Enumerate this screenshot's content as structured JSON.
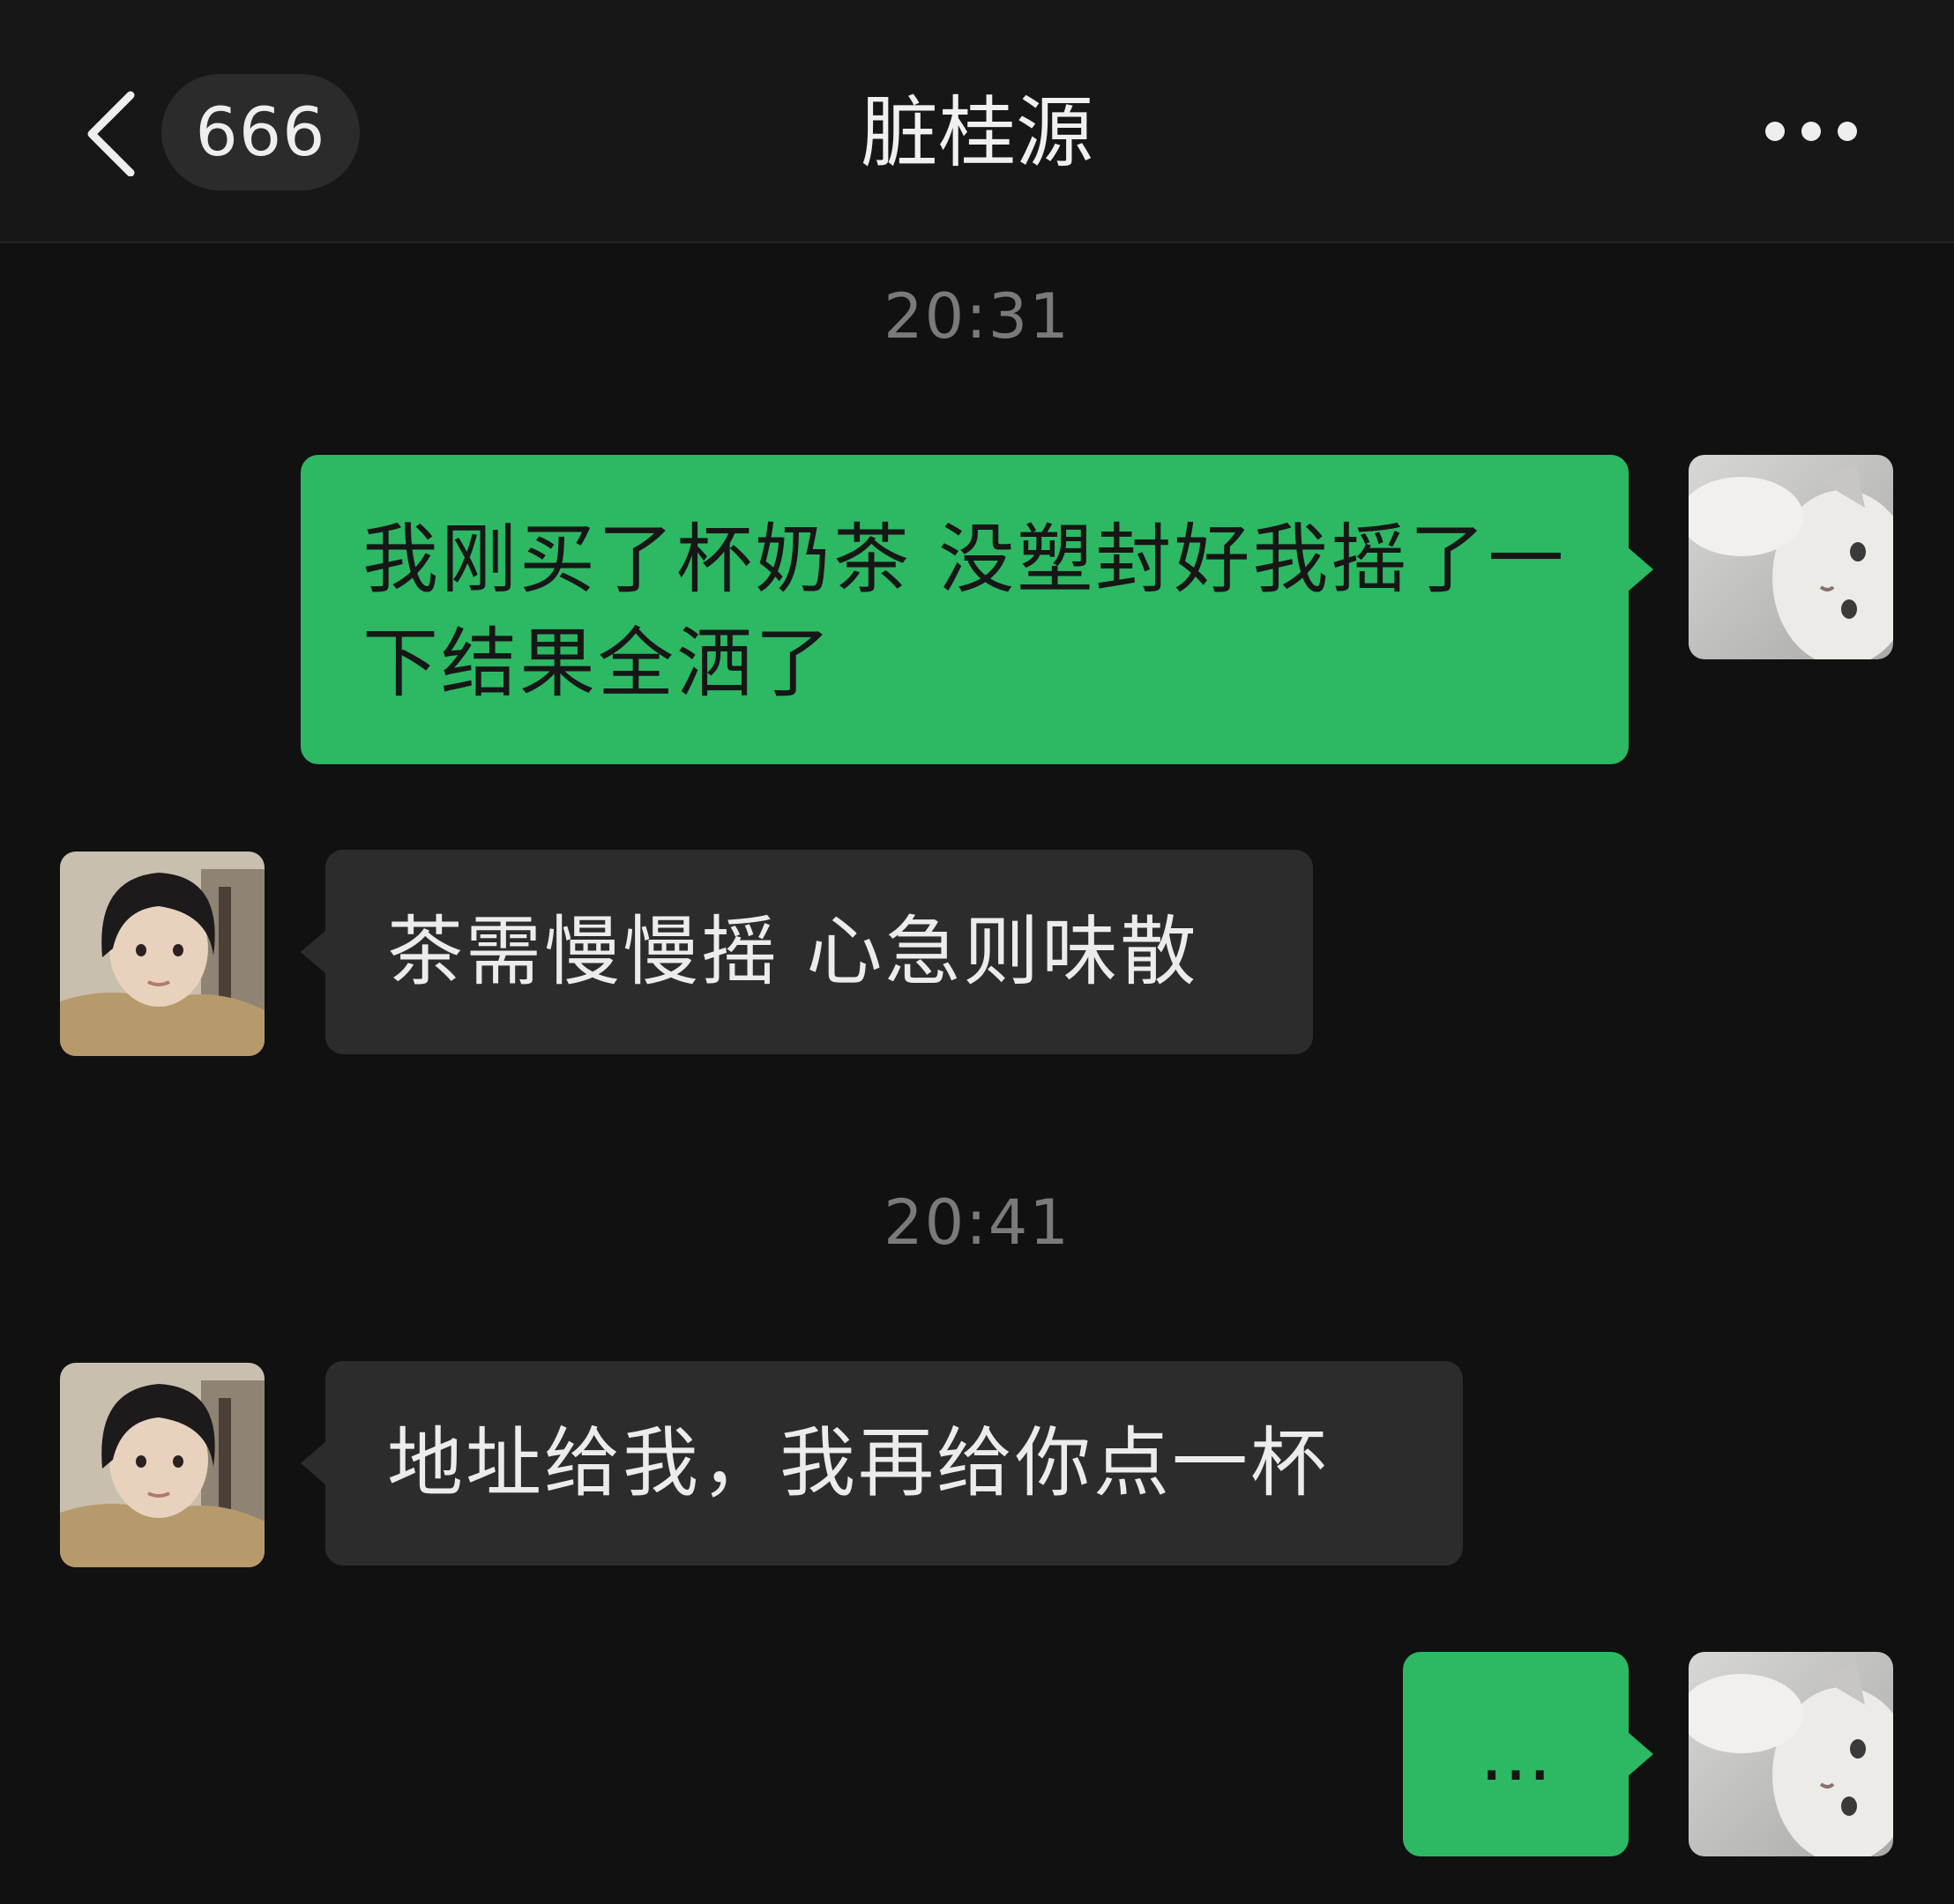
{
  "header": {
    "back_icon": "chevron-left-icon",
    "unread_count": "666",
    "title": "脏桂源",
    "more_icon": "more-horizontal-icon"
  },
  "messages": [
    {
      "type": "timestamp",
      "text": "20:31"
    },
    {
      "type": "message",
      "direction": "sent",
      "avatar": "cat-avatar",
      "text": "我刚买了杯奶茶 没塑封好我摇了一下结果全洒了"
    },
    {
      "type": "message",
      "direction": "received",
      "avatar": "contact-avatar",
      "text": "茶需慢慢摇 心急则味散"
    },
    {
      "type": "timestamp",
      "text": "20:41"
    },
    {
      "type": "message",
      "direction": "received",
      "avatar": "contact-avatar",
      "text": "地址给我，我再给你点一杯"
    },
    {
      "type": "message",
      "direction": "sent",
      "avatar": "cat-avatar",
      "text": "..."
    }
  ],
  "colors": {
    "background": "#111111",
    "sent_bubble": "#2db864",
    "received_bubble": "#2c2c2c",
    "timestamp": "#7a7a7a"
  }
}
